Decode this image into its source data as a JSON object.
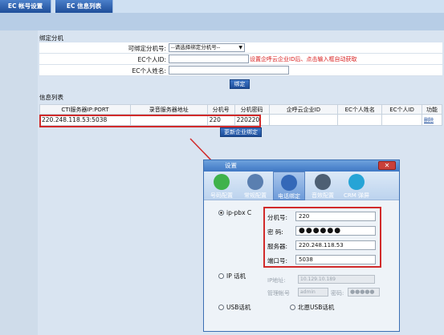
{
  "tabs": [
    {
      "label": "EC 帐号设置"
    },
    {
      "label": "EC 信息列表"
    }
  ],
  "bind_section": {
    "title": "绑定分机",
    "rows": [
      {
        "label": "可绑定分机号:",
        "select_value": "--请选择绑定分机号--"
      },
      {
        "label": "EC个人ID:",
        "hint": "设置企呼云企业ID后、点击输入框自动获取"
      },
      {
        "label": "EC个人姓名:"
      }
    ],
    "bind_button": "绑定"
  },
  "info_section": {
    "title": "信息列表",
    "headers": [
      "CTI服务器IP:PORT",
      "录音服务器地址",
      "分机号",
      "分机密码",
      "企呼云企业ID",
      "EC个人姓名",
      "EC个人ID",
      "功能"
    ],
    "row": [
      "220.248.118.53:5038",
      "",
      "220",
      "220220",
      "",
      "",
      "",
      "删除"
    ],
    "update_button": "更新企业绑定"
  },
  "dialog": {
    "title": "设置",
    "close_label": "✕",
    "toolbar": [
      "号码配置",
      "常规配置",
      "电话绑定",
      "音效配置",
      "CRM 弹屏"
    ],
    "radios": {
      "ippbx": "ip-pbx C",
      "ip_phone": "IP 话机",
      "usb_phone": "USB话机",
      "beien_usb": "北恩USB话机"
    },
    "fields": [
      {
        "label": "分机号:",
        "value": "220"
      },
      {
        "label": "密   码:",
        "value": "●●●●●●"
      },
      {
        "label": "服务器:",
        "value": "220.248.118.53"
      },
      {
        "label": "端口号:",
        "value": "5038"
      }
    ],
    "ip_phone_fields": {
      "ip_label": "IP地址:",
      "ip_value": "10.129.10.189",
      "admin_label": "管理帐号",
      "admin_value": "admin",
      "pwd_label": "密码:",
      "pwd_value": "●●●●●"
    }
  },
  "colors": {
    "highlight": "#d12a2a",
    "tab_blue": "#1f4e9a"
  }
}
